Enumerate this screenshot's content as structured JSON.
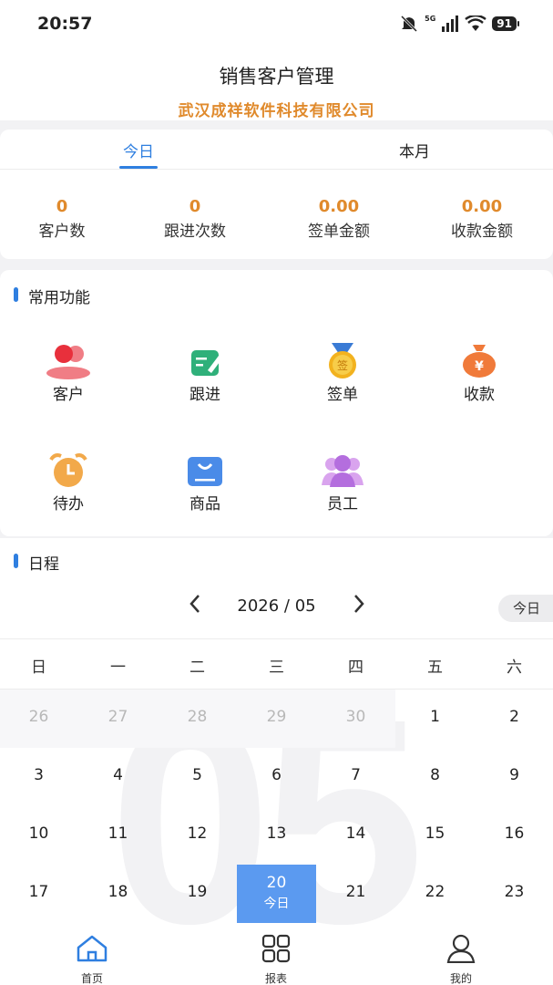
{
  "status": {
    "time": "20:57",
    "battery": "91",
    "network": "5G"
  },
  "header": {
    "title": "销售客户管理",
    "company": "武汉成祥软件科技有限公司"
  },
  "period_tabs": [
    {
      "label": "今日",
      "active": true
    },
    {
      "label": "本月",
      "active": false
    }
  ],
  "stats": [
    {
      "value": "0",
      "label": "客户数"
    },
    {
      "value": "0",
      "label": "跟进次数"
    },
    {
      "value": "0.00",
      "label": "签单金额"
    },
    {
      "value": "0.00",
      "label": "收款金额"
    }
  ],
  "functions": {
    "title": "常用功能",
    "items": [
      {
        "label": "客户",
        "icon": "customer-icon"
      },
      {
        "label": "跟进",
        "icon": "follow-up-icon"
      },
      {
        "label": "签单",
        "icon": "sign-medal-icon"
      },
      {
        "label": "收款",
        "icon": "money-bag-icon"
      },
      {
        "label": "待办",
        "icon": "alarm-clock-icon"
      },
      {
        "label": "商品",
        "icon": "product-box-icon"
      },
      {
        "label": "员工",
        "icon": "staff-icon"
      }
    ]
  },
  "schedule": {
    "title": "日程",
    "month_label": "2026 / 05",
    "watermark": "05",
    "today_button": "今日",
    "weekdays": [
      "日",
      "一",
      "二",
      "三",
      "四",
      "五",
      "六"
    ],
    "days": [
      {
        "d": "26",
        "muted": true
      },
      {
        "d": "27",
        "muted": true
      },
      {
        "d": "28",
        "muted": true
      },
      {
        "d": "29",
        "muted": true
      },
      {
        "d": "30",
        "muted": true
      },
      {
        "d": "1"
      },
      {
        "d": "2"
      },
      {
        "d": "3"
      },
      {
        "d": "4"
      },
      {
        "d": "5"
      },
      {
        "d": "6"
      },
      {
        "d": "7"
      },
      {
        "d": "8"
      },
      {
        "d": "9"
      },
      {
        "d": "10"
      },
      {
        "d": "11"
      },
      {
        "d": "12"
      },
      {
        "d": "13"
      },
      {
        "d": "14"
      },
      {
        "d": "15"
      },
      {
        "d": "16"
      },
      {
        "d": "17"
      },
      {
        "d": "18"
      },
      {
        "d": "19"
      },
      {
        "d": "20",
        "selected": true,
        "sub": "今日"
      },
      {
        "d": "21"
      },
      {
        "d": "22"
      },
      {
        "d": "23"
      }
    ]
  },
  "bottom_nav": [
    {
      "label": "首页",
      "icon": "home-icon",
      "active": true
    },
    {
      "label": "报表",
      "icon": "report-grid-icon",
      "active": false
    },
    {
      "label": "我的",
      "icon": "profile-icon",
      "active": false
    }
  ],
  "colors": {
    "accent": "#2f7fe0",
    "orange": "#e08a2c",
    "selected_day": "#5b9af0"
  }
}
